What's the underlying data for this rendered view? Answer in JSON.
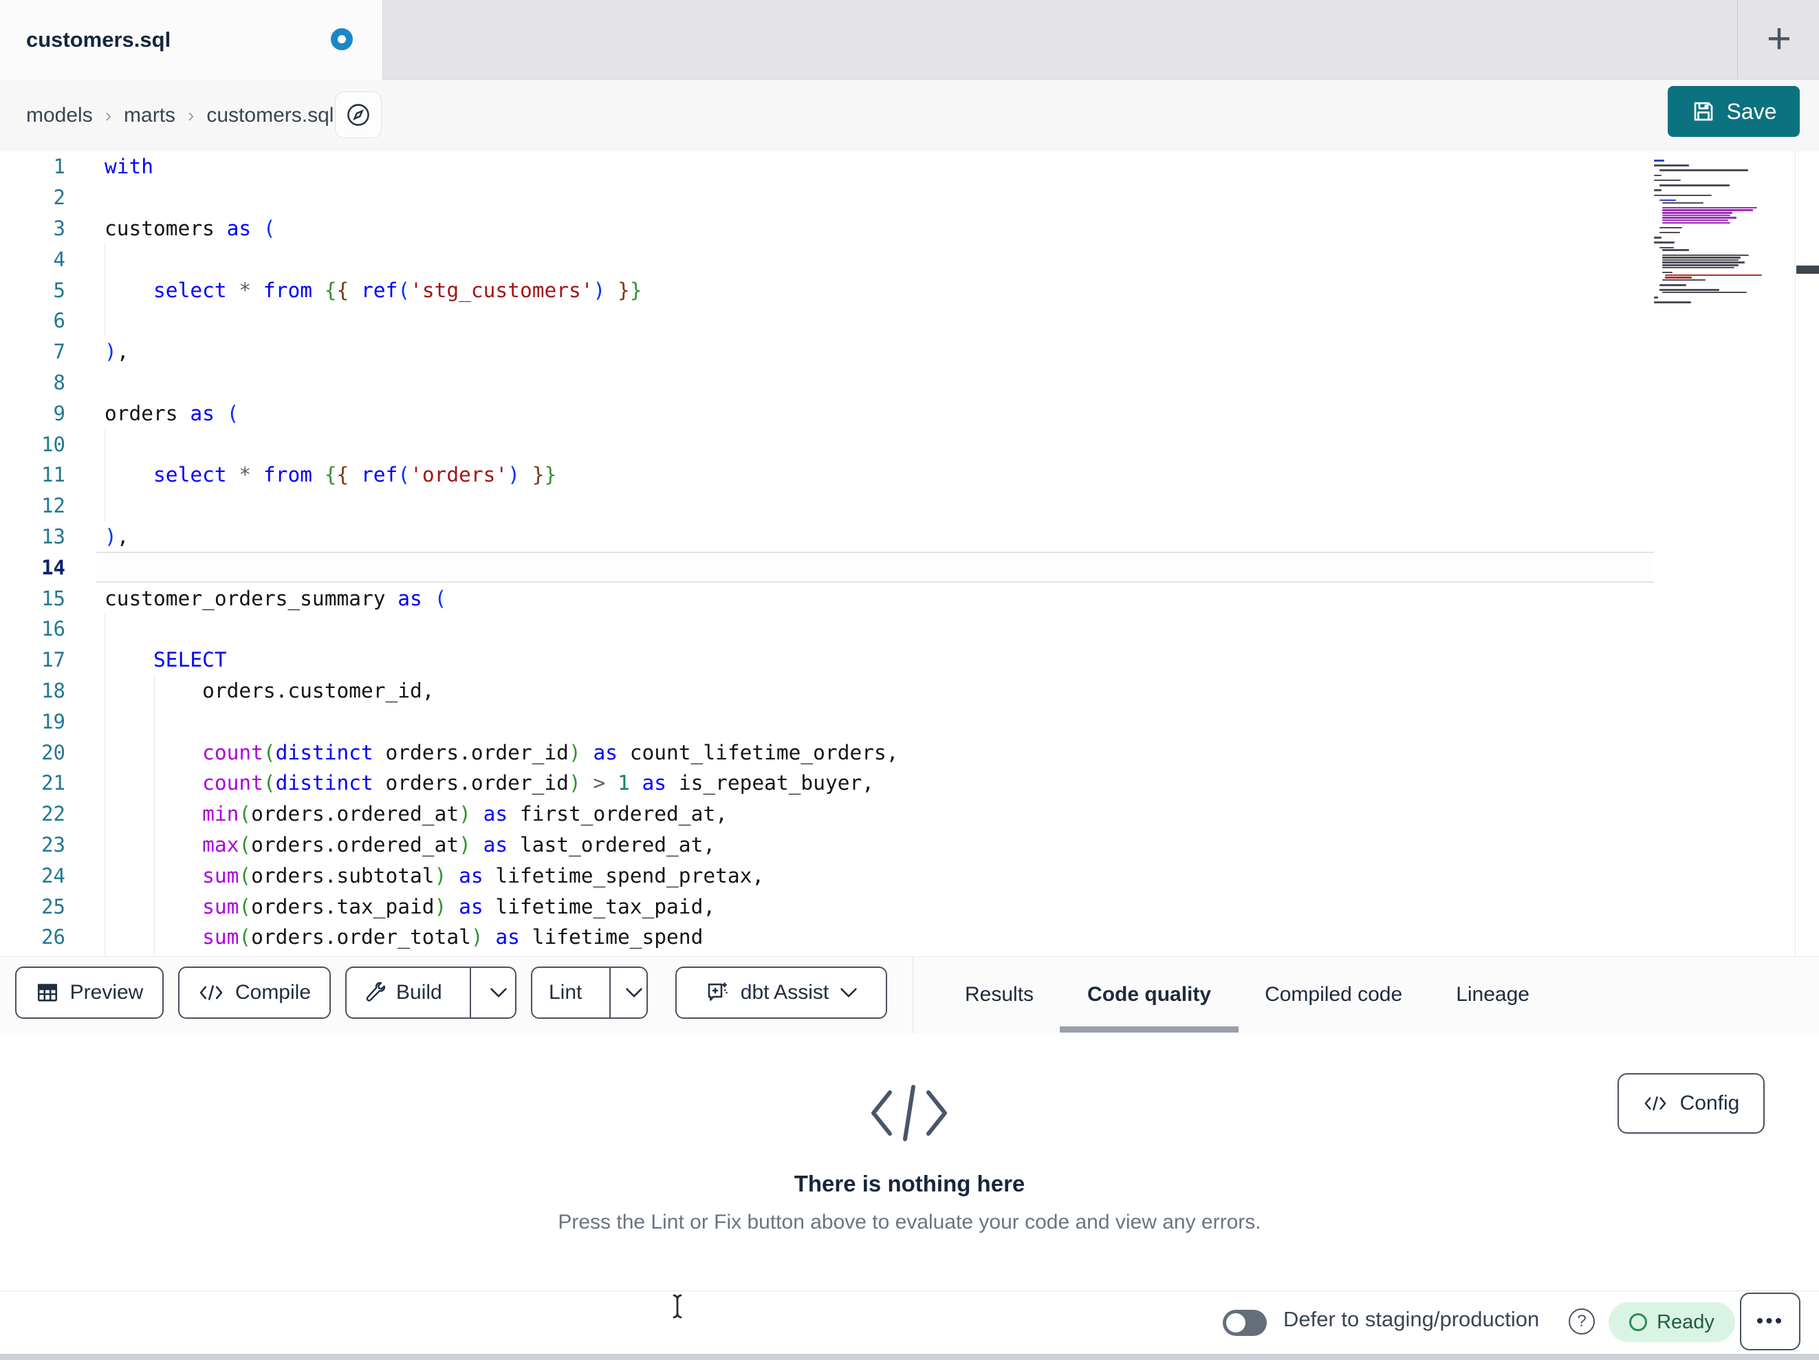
{
  "tab_bar": {
    "tab_title": "customers.sql",
    "new_tab_label": "+",
    "modified_dot_color": "#1a87c9"
  },
  "breadcrumb": {
    "items": [
      "models",
      "marts",
      "customers.sql"
    ],
    "separator": "›"
  },
  "save_button": {
    "label": "Save",
    "color": "#0d7280"
  },
  "editor": {
    "active_line": 14,
    "lines": [
      {
        "n": 1,
        "segs": [
          [
            "with",
            "kw"
          ]
        ]
      },
      {
        "n": 2,
        "segs": []
      },
      {
        "n": 3,
        "segs": [
          [
            "customers ",
            "pl"
          ],
          [
            "as",
            "kw"
          ],
          [
            " ",
            "pl"
          ],
          [
            "(",
            "b1"
          ]
        ]
      },
      {
        "n": 4,
        "segs": []
      },
      {
        "n": 5,
        "segs": [
          [
            "    ",
            "pl"
          ],
          [
            "select",
            "kw"
          ],
          [
            " ",
            "pl"
          ],
          [
            "*",
            "op"
          ],
          [
            " ",
            "pl"
          ],
          [
            "from",
            "kw"
          ],
          [
            " ",
            "pl"
          ],
          [
            "{",
            "b2"
          ],
          [
            "{",
            "b3"
          ],
          [
            " ",
            "pl"
          ],
          [
            "ref",
            "kw"
          ],
          [
            "(",
            "b1"
          ],
          [
            "'stg_customers'",
            "str"
          ],
          [
            ")",
            "b1"
          ],
          [
            " ",
            "pl"
          ],
          [
            "}",
            "b3"
          ],
          [
            "}",
            "b2"
          ]
        ]
      },
      {
        "n": 6,
        "segs": []
      },
      {
        "n": 7,
        "segs": [
          [
            ")",
            "b1"
          ],
          [
            ",",
            "pl"
          ]
        ]
      },
      {
        "n": 8,
        "segs": []
      },
      {
        "n": 9,
        "segs": [
          [
            "orders ",
            "pl"
          ],
          [
            "as",
            "kw"
          ],
          [
            " ",
            "pl"
          ],
          [
            "(",
            "b1"
          ]
        ]
      },
      {
        "n": 10,
        "segs": []
      },
      {
        "n": 11,
        "segs": [
          [
            "    ",
            "pl"
          ],
          [
            "select",
            "kw"
          ],
          [
            " ",
            "pl"
          ],
          [
            "*",
            "op"
          ],
          [
            " ",
            "pl"
          ],
          [
            "from",
            "kw"
          ],
          [
            " ",
            "pl"
          ],
          [
            "{",
            "b2"
          ],
          [
            "{",
            "b3"
          ],
          [
            " ",
            "pl"
          ],
          [
            "ref",
            "kw"
          ],
          [
            "(",
            "b1"
          ],
          [
            "'orders'",
            "str"
          ],
          [
            ")",
            "b1"
          ],
          [
            " ",
            "pl"
          ],
          [
            "}",
            "b3"
          ],
          [
            "}",
            "b2"
          ]
        ]
      },
      {
        "n": 12,
        "segs": []
      },
      {
        "n": 13,
        "segs": [
          [
            ")",
            "b1"
          ],
          [
            ",",
            "pl"
          ]
        ]
      },
      {
        "n": 14,
        "segs": []
      },
      {
        "n": 15,
        "segs": [
          [
            "customer_orders_summary ",
            "pl"
          ],
          [
            "as",
            "kw"
          ],
          [
            " ",
            "pl"
          ],
          [
            "(",
            "b1"
          ]
        ]
      },
      {
        "n": 16,
        "segs": []
      },
      {
        "n": 17,
        "segs": [
          [
            "    ",
            "pl"
          ],
          [
            "SELECT",
            "kw"
          ]
        ]
      },
      {
        "n": 18,
        "segs": [
          [
            "        orders.customer_id,",
            "pl"
          ]
        ]
      },
      {
        "n": 19,
        "segs": []
      },
      {
        "n": 20,
        "segs": [
          [
            "        ",
            "pl"
          ],
          [
            "count",
            "fn"
          ],
          [
            "(",
            "b2"
          ],
          [
            "distinct",
            "kw"
          ],
          [
            " orders.order_id",
            "pl"
          ],
          [
            ")",
            "b2"
          ],
          [
            " ",
            "pl"
          ],
          [
            "as",
            "kw"
          ],
          [
            " count_lifetime_orders,",
            "pl"
          ]
        ]
      },
      {
        "n": 21,
        "segs": [
          [
            "        ",
            "pl"
          ],
          [
            "count",
            "fn"
          ],
          [
            "(",
            "b2"
          ],
          [
            "distinct",
            "kw"
          ],
          [
            " orders.order_id",
            "pl"
          ],
          [
            ")",
            "b2"
          ],
          [
            " ",
            "pl"
          ],
          [
            ">",
            "op"
          ],
          [
            " ",
            "pl"
          ],
          [
            "1",
            "num"
          ],
          [
            " ",
            "pl"
          ],
          [
            "as",
            "kw"
          ],
          [
            " is_repeat_buyer,",
            "pl"
          ]
        ]
      },
      {
        "n": 22,
        "segs": [
          [
            "        ",
            "pl"
          ],
          [
            "min",
            "fn"
          ],
          [
            "(",
            "b2"
          ],
          [
            "orders.ordered_at",
            "pl"
          ],
          [
            ")",
            "b2"
          ],
          [
            " ",
            "pl"
          ],
          [
            "as",
            "kw"
          ],
          [
            " first_ordered_at,",
            "pl"
          ]
        ]
      },
      {
        "n": 23,
        "segs": [
          [
            "        ",
            "pl"
          ],
          [
            "max",
            "fn"
          ],
          [
            "(",
            "b2"
          ],
          [
            "orders.ordered_at",
            "pl"
          ],
          [
            ")",
            "b2"
          ],
          [
            " ",
            "pl"
          ],
          [
            "as",
            "kw"
          ],
          [
            " last_ordered_at,",
            "pl"
          ]
        ]
      },
      {
        "n": 24,
        "segs": [
          [
            "        ",
            "pl"
          ],
          [
            "sum",
            "fn"
          ],
          [
            "(",
            "b2"
          ],
          [
            "orders.subtotal",
            "pl"
          ],
          [
            ")",
            "b2"
          ],
          [
            " ",
            "pl"
          ],
          [
            "as",
            "kw"
          ],
          [
            " lifetime_spend_pretax,",
            "pl"
          ]
        ]
      },
      {
        "n": 25,
        "segs": [
          [
            "        ",
            "pl"
          ],
          [
            "sum",
            "fn"
          ],
          [
            "(",
            "b2"
          ],
          [
            "orders.tax_paid",
            "pl"
          ],
          [
            ")",
            "b2"
          ],
          [
            " ",
            "pl"
          ],
          [
            "as",
            "kw"
          ],
          [
            " lifetime_tax_paid,",
            "pl"
          ]
        ]
      },
      {
        "n": 26,
        "segs": [
          [
            "        ",
            "pl"
          ],
          [
            "sum",
            "fn"
          ],
          [
            "(",
            "b2"
          ],
          [
            "orders.order_total",
            "pl"
          ],
          [
            ")",
            "b2"
          ],
          [
            " ",
            "pl"
          ],
          [
            "as",
            "kw"
          ],
          [
            " lifetime_spend",
            "pl"
          ]
        ]
      }
    ],
    "syntax_colors": {
      "keyword": "#0000ff",
      "function": "#af00db",
      "string": "#a31515",
      "number": "#098658",
      "bracket1": "#0431fa",
      "bracket2": "#319331",
      "bracket3": "#7b3814",
      "line_number": "#237893",
      "active_line_number": "#0b216f"
    }
  },
  "minimap_lines": [
    [
      0,
      10,
      "b"
    ],
    [
      0,
      0,
      "d"
    ],
    [
      0,
      34,
      "d"
    ],
    [
      0,
      0,
      "d"
    ],
    [
      8,
      86,
      "d"
    ],
    [
      0,
      0,
      "d"
    ],
    [
      0,
      7,
      "d"
    ],
    [
      0,
      0,
      "d"
    ],
    [
      0,
      26,
      "d"
    ],
    [
      0,
      0,
      "d"
    ],
    [
      8,
      68,
      "d"
    ],
    [
      0,
      0,
      "d"
    ],
    [
      0,
      7,
      "d"
    ],
    [
      0,
      0,
      "d"
    ],
    [
      0,
      56,
      "d"
    ],
    [
      0,
      0,
      "d"
    ],
    [
      8,
      16,
      "b"
    ],
    [
      12,
      40,
      "d"
    ],
    [
      0,
      0,
      "d"
    ],
    [
      12,
      92,
      "m"
    ],
    [
      12,
      88,
      "m"
    ],
    [
      12,
      68,
      "m"
    ],
    [
      12,
      66,
      "m"
    ],
    [
      12,
      72,
      "m"
    ],
    [
      12,
      64,
      "m"
    ],
    [
      12,
      66,
      "m"
    ],
    [
      0,
      0,
      "d"
    ],
    [
      8,
      22,
      "d"
    ],
    [
      0,
      0,
      "d"
    ],
    [
      8,
      20,
      "d"
    ],
    [
      0,
      0,
      "d"
    ],
    [
      0,
      7,
      "d"
    ],
    [
      0,
      0,
      "d"
    ],
    [
      0,
      20,
      "d"
    ],
    [
      0,
      0,
      "d"
    ],
    [
      8,
      14,
      "d"
    ],
    [
      12,
      26,
      "d"
    ],
    [
      0,
      0,
      "d"
    ],
    [
      12,
      84,
      "d"
    ],
    [
      12,
      76,
      "d"
    ],
    [
      12,
      74,
      "d"
    ],
    [
      12,
      80,
      "d"
    ],
    [
      12,
      74,
      "d"
    ],
    [
      12,
      70,
      "d"
    ],
    [
      0,
      0,
      "d"
    ],
    [
      12,
      10,
      "d"
    ],
    [
      16,
      94,
      "r"
    ],
    [
      16,
      26,
      "r"
    ],
    [
      12,
      42,
      "d"
    ],
    [
      0,
      0,
      "d"
    ],
    [
      8,
      26,
      "d"
    ],
    [
      0,
      0,
      "d"
    ],
    [
      8,
      58,
      "d"
    ],
    [
      12,
      82,
      "d"
    ],
    [
      0,
      0,
      "d"
    ],
    [
      0,
      4,
      "d"
    ],
    [
      0,
      0,
      "d"
    ],
    [
      0,
      36,
      "d"
    ]
  ],
  "toolbar": {
    "preview_label": "Preview",
    "compile_label": "Compile",
    "build_label": "Build",
    "lint_label": "Lint",
    "dbt_assist_label": "dbt Assist"
  },
  "panel_tabs": [
    {
      "label": "Results",
      "active": false
    },
    {
      "label": "Code quality",
      "active": true
    },
    {
      "label": "Compiled code",
      "active": false
    },
    {
      "label": "Lineage",
      "active": false
    }
  ],
  "results_panel": {
    "empty_title": "There is nothing here",
    "empty_subtitle": "Press the Lint or Fix button above to evaluate your code and view any errors.",
    "config_label": "Config"
  },
  "status_bar": {
    "defer_label": "Defer to staging/production",
    "help_glyph": "?",
    "ready_label": "Ready",
    "more_label": "•••",
    "ready_bg": "#d9f4e3",
    "ready_text_color": "#215c40"
  }
}
